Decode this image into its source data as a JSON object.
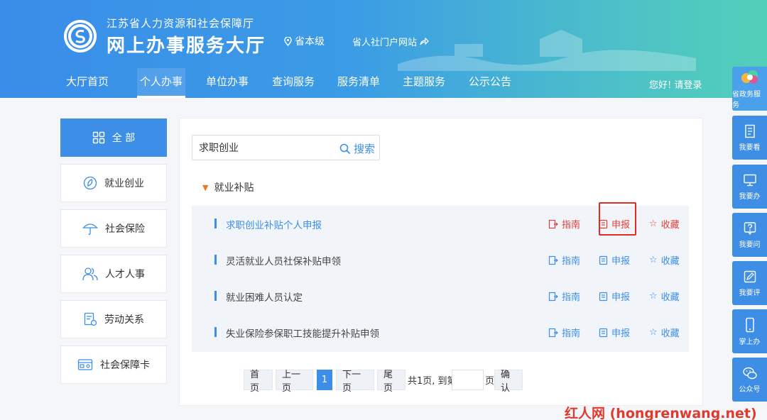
{
  "header": {
    "org_name": "江苏省人力资源和社会保障厅",
    "site_name": "网上办事服务大厅",
    "region": "省本级",
    "portal_link": "省人社门户网站",
    "login": "您好! 请登录"
  },
  "nav": {
    "items": [
      {
        "label": "大厅首页"
      },
      {
        "label": "个人办事",
        "active": true
      },
      {
        "label": "单位办事"
      },
      {
        "label": "查询服务"
      },
      {
        "label": "服务清单"
      },
      {
        "label": "主题服务"
      },
      {
        "label": "公示公告"
      }
    ]
  },
  "sidebar": {
    "items": [
      {
        "label": "全 部",
        "icon": "grid-icon",
        "active": true
      },
      {
        "label": "就业创业",
        "icon": "leaf-icon"
      },
      {
        "label": "社会保险",
        "icon": "umbrella-icon"
      },
      {
        "label": "人才人事",
        "icon": "people-icon"
      },
      {
        "label": "劳动关系",
        "icon": "document-icon"
      },
      {
        "label": "社会保障卡",
        "icon": "card-icon"
      }
    ]
  },
  "search": {
    "value": "求职创业",
    "button": "搜索"
  },
  "category": {
    "label": "就业补贴"
  },
  "services": [
    {
      "title": "求职创业补贴个人申报",
      "guide": "指南",
      "apply": "申报",
      "fav": "收藏",
      "highlighted": true
    },
    {
      "title": "灵活就业人员社保补贴申领",
      "guide": "指南",
      "apply": "申报",
      "fav": "收藏"
    },
    {
      "title": "就业困难人员认定",
      "guide": "指南",
      "apply": "申报",
      "fav": "收藏"
    },
    {
      "title": "失业保险参保职工技能提升补贴申领",
      "guide": "指南",
      "apply": "申报",
      "fav": "收藏"
    }
  ],
  "pagination": {
    "first": "首页",
    "prev": "上一页",
    "current": "1",
    "next": "下一页",
    "last": "尾页",
    "summary": "共1页, 到第",
    "page_unit": "页",
    "confirm": "确认"
  },
  "right_bar": {
    "items": [
      {
        "label": "省政务服务",
        "icon": "gov-logo-icon"
      },
      {
        "label": "我要看",
        "icon": "book-icon"
      },
      {
        "label": "我要办",
        "icon": "monitor-icon"
      },
      {
        "label": "我要问",
        "icon": "question-icon"
      },
      {
        "label": "我要评",
        "icon": "edit-icon"
      },
      {
        "label": "掌上办",
        "icon": "phone-icon"
      },
      {
        "label": "公众号",
        "icon": "wechat-icon"
      }
    ]
  },
  "watermark": "红人网 (hongrenwang.net)",
  "colors": {
    "primary": "#3c8ee6",
    "accent_red": "#e0403a",
    "highlight_box": "#e22b22"
  }
}
